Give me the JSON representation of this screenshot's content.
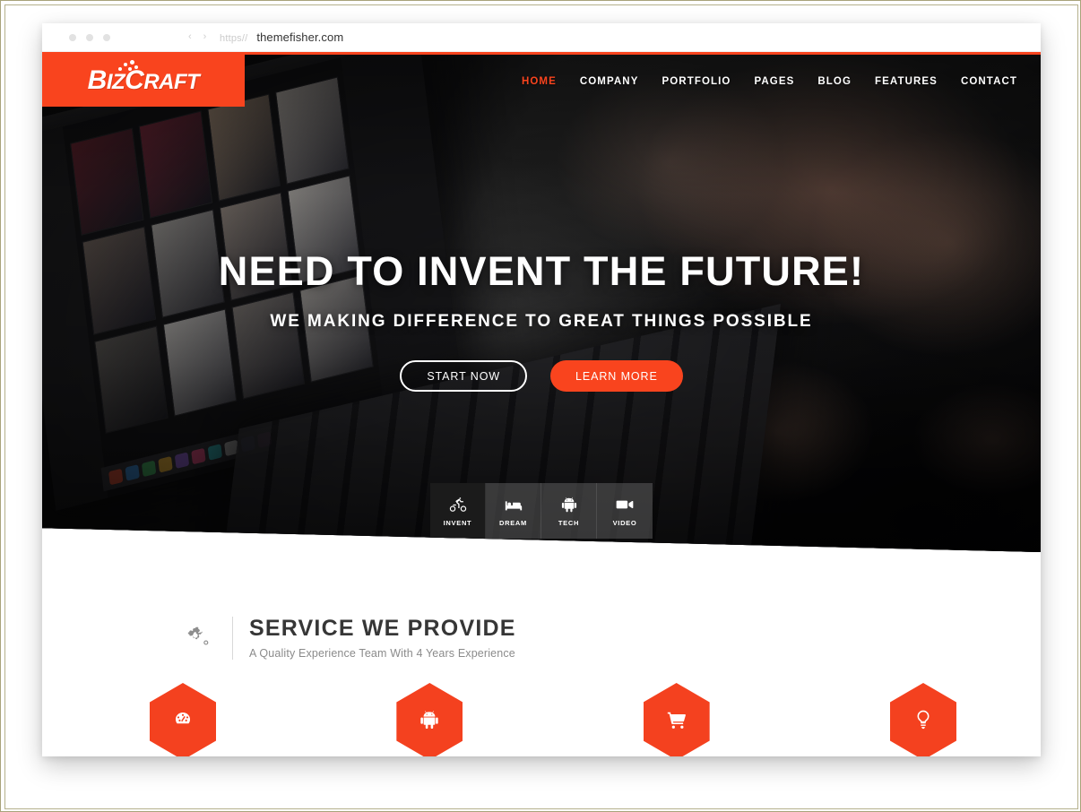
{
  "browser": {
    "url_scheme": "https//",
    "url_host": "themefisher.com",
    "back_arrow": "‹",
    "forward_arrow": "›"
  },
  "site": {
    "logo": {
      "part1": "B",
      "part2": "IZ",
      "part3": "C",
      "part4": "RAFT",
      "full": "BIZCRAFT"
    },
    "nav": [
      {
        "label": "HOME",
        "active": true
      },
      {
        "label": "COMPANY",
        "active": false
      },
      {
        "label": "PORTFOLIO",
        "active": false
      },
      {
        "label": "PAGES",
        "active": false
      },
      {
        "label": "BLOG",
        "active": false
      },
      {
        "label": "FEATURES",
        "active": false
      },
      {
        "label": "CONTACT",
        "active": false
      }
    ],
    "hero": {
      "title": "NEED TO INVENT THE FUTURE!",
      "subtitle": "WE MAKING DIFFERENCE TO GREAT THINGS POSSIBLE",
      "primary_button": "START NOW",
      "secondary_button": "LEARN MORE",
      "tabs": [
        {
          "label": "INVENT",
          "icon": "bicycle-icon",
          "active": true
        },
        {
          "label": "DREAM",
          "icon": "bed-icon",
          "active": false
        },
        {
          "label": "TECH",
          "icon": "android-icon",
          "active": false
        },
        {
          "label": "VIDEO",
          "icon": "video-camera-icon",
          "active": false
        }
      ]
    },
    "services": {
      "icon": "gears-icon",
      "title": "SERVICE WE PROVIDE",
      "subtitle": "A Quality Experience Team With 4 Years Experience",
      "items": [
        {
          "icon": "dashboard-gauge-icon"
        },
        {
          "icon": "android-icon"
        },
        {
          "icon": "shopping-cart-icon"
        },
        {
          "icon": "lightbulb-icon"
        }
      ]
    }
  },
  "colors": {
    "brand_orange": "#f9441e",
    "hex_orange": "#f4411f",
    "nav_text": "#ffffff",
    "heading": "#363636",
    "muted": "#8b8b8b",
    "frame_border": "#a8a37a"
  }
}
